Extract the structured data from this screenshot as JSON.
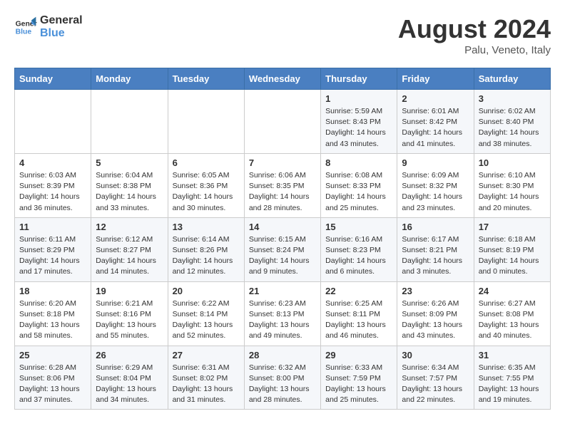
{
  "header": {
    "logo_line1": "General",
    "logo_line2": "Blue",
    "month_year": "August 2024",
    "location": "Palu, Veneto, Italy"
  },
  "days_of_week": [
    "Sunday",
    "Monday",
    "Tuesday",
    "Wednesday",
    "Thursday",
    "Friday",
    "Saturday"
  ],
  "weeks": [
    [
      {
        "day": "",
        "info": ""
      },
      {
        "day": "",
        "info": ""
      },
      {
        "day": "",
        "info": ""
      },
      {
        "day": "",
        "info": ""
      },
      {
        "day": "1",
        "info": "Sunrise: 5:59 AM\nSunset: 8:43 PM\nDaylight: 14 hours\nand 43 minutes."
      },
      {
        "day": "2",
        "info": "Sunrise: 6:01 AM\nSunset: 8:42 PM\nDaylight: 14 hours\nand 41 minutes."
      },
      {
        "day": "3",
        "info": "Sunrise: 6:02 AM\nSunset: 8:40 PM\nDaylight: 14 hours\nand 38 minutes."
      }
    ],
    [
      {
        "day": "4",
        "info": "Sunrise: 6:03 AM\nSunset: 8:39 PM\nDaylight: 14 hours\nand 36 minutes."
      },
      {
        "day": "5",
        "info": "Sunrise: 6:04 AM\nSunset: 8:38 PM\nDaylight: 14 hours\nand 33 minutes."
      },
      {
        "day": "6",
        "info": "Sunrise: 6:05 AM\nSunset: 8:36 PM\nDaylight: 14 hours\nand 30 minutes."
      },
      {
        "day": "7",
        "info": "Sunrise: 6:06 AM\nSunset: 8:35 PM\nDaylight: 14 hours\nand 28 minutes."
      },
      {
        "day": "8",
        "info": "Sunrise: 6:08 AM\nSunset: 8:33 PM\nDaylight: 14 hours\nand 25 minutes."
      },
      {
        "day": "9",
        "info": "Sunrise: 6:09 AM\nSunset: 8:32 PM\nDaylight: 14 hours\nand 23 minutes."
      },
      {
        "day": "10",
        "info": "Sunrise: 6:10 AM\nSunset: 8:30 PM\nDaylight: 14 hours\nand 20 minutes."
      }
    ],
    [
      {
        "day": "11",
        "info": "Sunrise: 6:11 AM\nSunset: 8:29 PM\nDaylight: 14 hours\nand 17 minutes."
      },
      {
        "day": "12",
        "info": "Sunrise: 6:12 AM\nSunset: 8:27 PM\nDaylight: 14 hours\nand 14 minutes."
      },
      {
        "day": "13",
        "info": "Sunrise: 6:14 AM\nSunset: 8:26 PM\nDaylight: 14 hours\nand 12 minutes."
      },
      {
        "day": "14",
        "info": "Sunrise: 6:15 AM\nSunset: 8:24 PM\nDaylight: 14 hours\nand 9 minutes."
      },
      {
        "day": "15",
        "info": "Sunrise: 6:16 AM\nSunset: 8:23 PM\nDaylight: 14 hours\nand 6 minutes."
      },
      {
        "day": "16",
        "info": "Sunrise: 6:17 AM\nSunset: 8:21 PM\nDaylight: 14 hours\nand 3 minutes."
      },
      {
        "day": "17",
        "info": "Sunrise: 6:18 AM\nSunset: 8:19 PM\nDaylight: 14 hours\nand 0 minutes."
      }
    ],
    [
      {
        "day": "18",
        "info": "Sunrise: 6:20 AM\nSunset: 8:18 PM\nDaylight: 13 hours\nand 58 minutes."
      },
      {
        "day": "19",
        "info": "Sunrise: 6:21 AM\nSunset: 8:16 PM\nDaylight: 13 hours\nand 55 minutes."
      },
      {
        "day": "20",
        "info": "Sunrise: 6:22 AM\nSunset: 8:14 PM\nDaylight: 13 hours\nand 52 minutes."
      },
      {
        "day": "21",
        "info": "Sunrise: 6:23 AM\nSunset: 8:13 PM\nDaylight: 13 hours\nand 49 minutes."
      },
      {
        "day": "22",
        "info": "Sunrise: 6:25 AM\nSunset: 8:11 PM\nDaylight: 13 hours\nand 46 minutes."
      },
      {
        "day": "23",
        "info": "Sunrise: 6:26 AM\nSunset: 8:09 PM\nDaylight: 13 hours\nand 43 minutes."
      },
      {
        "day": "24",
        "info": "Sunrise: 6:27 AM\nSunset: 8:08 PM\nDaylight: 13 hours\nand 40 minutes."
      }
    ],
    [
      {
        "day": "25",
        "info": "Sunrise: 6:28 AM\nSunset: 8:06 PM\nDaylight: 13 hours\nand 37 minutes."
      },
      {
        "day": "26",
        "info": "Sunrise: 6:29 AM\nSunset: 8:04 PM\nDaylight: 13 hours\nand 34 minutes."
      },
      {
        "day": "27",
        "info": "Sunrise: 6:31 AM\nSunset: 8:02 PM\nDaylight: 13 hours\nand 31 minutes."
      },
      {
        "day": "28",
        "info": "Sunrise: 6:32 AM\nSunset: 8:00 PM\nDaylight: 13 hours\nand 28 minutes."
      },
      {
        "day": "29",
        "info": "Sunrise: 6:33 AM\nSunset: 7:59 PM\nDaylight: 13 hours\nand 25 minutes."
      },
      {
        "day": "30",
        "info": "Sunrise: 6:34 AM\nSunset: 7:57 PM\nDaylight: 13 hours\nand 22 minutes."
      },
      {
        "day": "31",
        "info": "Sunrise: 6:35 AM\nSunset: 7:55 PM\nDaylight: 13 hours\nand 19 minutes."
      }
    ]
  ]
}
